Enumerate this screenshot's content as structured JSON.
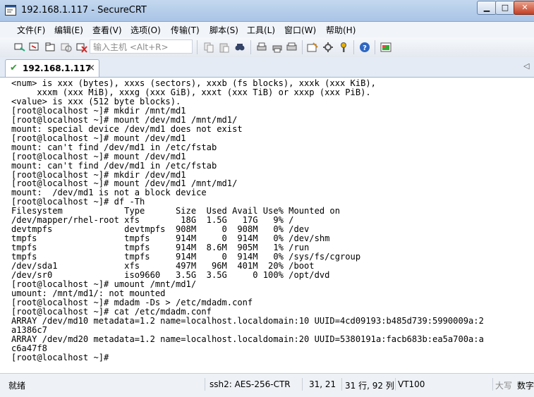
{
  "window": {
    "title": "192.168.1.117 - SecureCRT",
    "min_glyph": "▁",
    "max_glyph": "□",
    "close_glyph": "✕"
  },
  "menu": [
    "文件(F)",
    "编辑(E)",
    "查看(V)",
    "选项(O)",
    "传输(T)",
    "脚本(S)",
    "工具(L)",
    "窗口(W)",
    "帮助(H)"
  ],
  "toolbar": {
    "quick_connect_placeholder": "输入主机 <Alt+R>",
    "icons": [
      "connect-icon",
      "quick-connect-icon",
      "connect-tab-icon",
      "reconnect-icon",
      "disconnect-icon",
      "copy-icon",
      "paste-icon",
      "find-icon",
      "print-setup-icon",
      "print-icon",
      "print-screen-icon",
      "session-options-icon",
      "global-options-icon",
      "keymap-icon",
      "help-icon",
      "sftp-icon"
    ]
  },
  "tab": {
    "label": "192.168.1.117",
    "close_glyph": "×",
    "scroll_glyph": "◁"
  },
  "terminal": {
    "lines": [
      "<num> is xxx (bytes), xxxs (sectors), xxxb (fs blocks), xxxk (xxx KiB),",
      "     xxxm (xxx MiB), xxxg (xxx GiB), xxxt (xxx TiB) or xxxp (xxx PiB).",
      "<value> is xxx (512 byte blocks).",
      "[root@localhost ~]# mkdir /mnt/md1",
      "[root@localhost ~]# mount /dev/md1 /mnt/md1/",
      "mount: special device /dev/md1 does not exist",
      "[root@localhost ~]# mount /dev/md1",
      "mount: can't find /dev/md1 in /etc/fstab",
      "[root@localhost ~]# mount /dev/md1",
      "mount: can't find /dev/md1 in /etc/fstab",
      "[root@localhost ~]# mkdir /dev/md1",
      "[root@localhost ~]# mount /dev/md1 /mnt/md1/",
      "mount:  /dev/md1 is not a block device",
      "[root@localhost ~]# df -Th",
      "Filesystem            Type      Size  Used Avail Use% Mounted on",
      "/dev/mapper/rhel-root xfs        18G  1.5G   17G   9% /",
      "devtmpfs              devtmpfs  908M     0  908M   0% /dev",
      "tmpfs                 tmpfs     914M     0  914M   0% /dev/shm",
      "tmpfs                 tmpfs     914M  8.6M  905M   1% /run",
      "tmpfs                 tmpfs     914M     0  914M   0% /sys/fs/cgroup",
      "/dev/sda1             xfs       497M   96M  401M  20% /boot",
      "/dev/sr0              iso9660   3.5G  3.5G     0 100% /opt/dvd",
      "[root@localhost ~]# umount /mnt/md1/",
      "umount: /mnt/md1/: not mounted",
      "[root@localhost ~]# mdadm -Ds > /etc/mdadm.conf",
      "[root@localhost ~]# cat /etc/mdadm.conf",
      "ARRAY /dev/md10 metadata=1.2 name=localhost.localdomain:10 UUID=4cd09193:b485d739:5990009a:2",
      "a1386c7",
      "ARRAY /dev/md20 metadata=1.2 name=localhost.localdomain:20 UUID=5380191a:facb683b:ea5a700a:a",
      "c6a47f8",
      "[root@localhost ~]#"
    ]
  },
  "status": {
    "ready": "就绪",
    "cipher": "ssh2: AES-256-CTR",
    "cursor_pos": "31,  21",
    "rows_cols": "31 行, 92 列",
    "emulation": "VT100",
    "caps": "大写",
    "num": "数字"
  },
  "colors": {
    "title_bg": "#b3cbe9",
    "terminal_bg": "#ffffff",
    "accent_check": "#3a9a3a"
  }
}
